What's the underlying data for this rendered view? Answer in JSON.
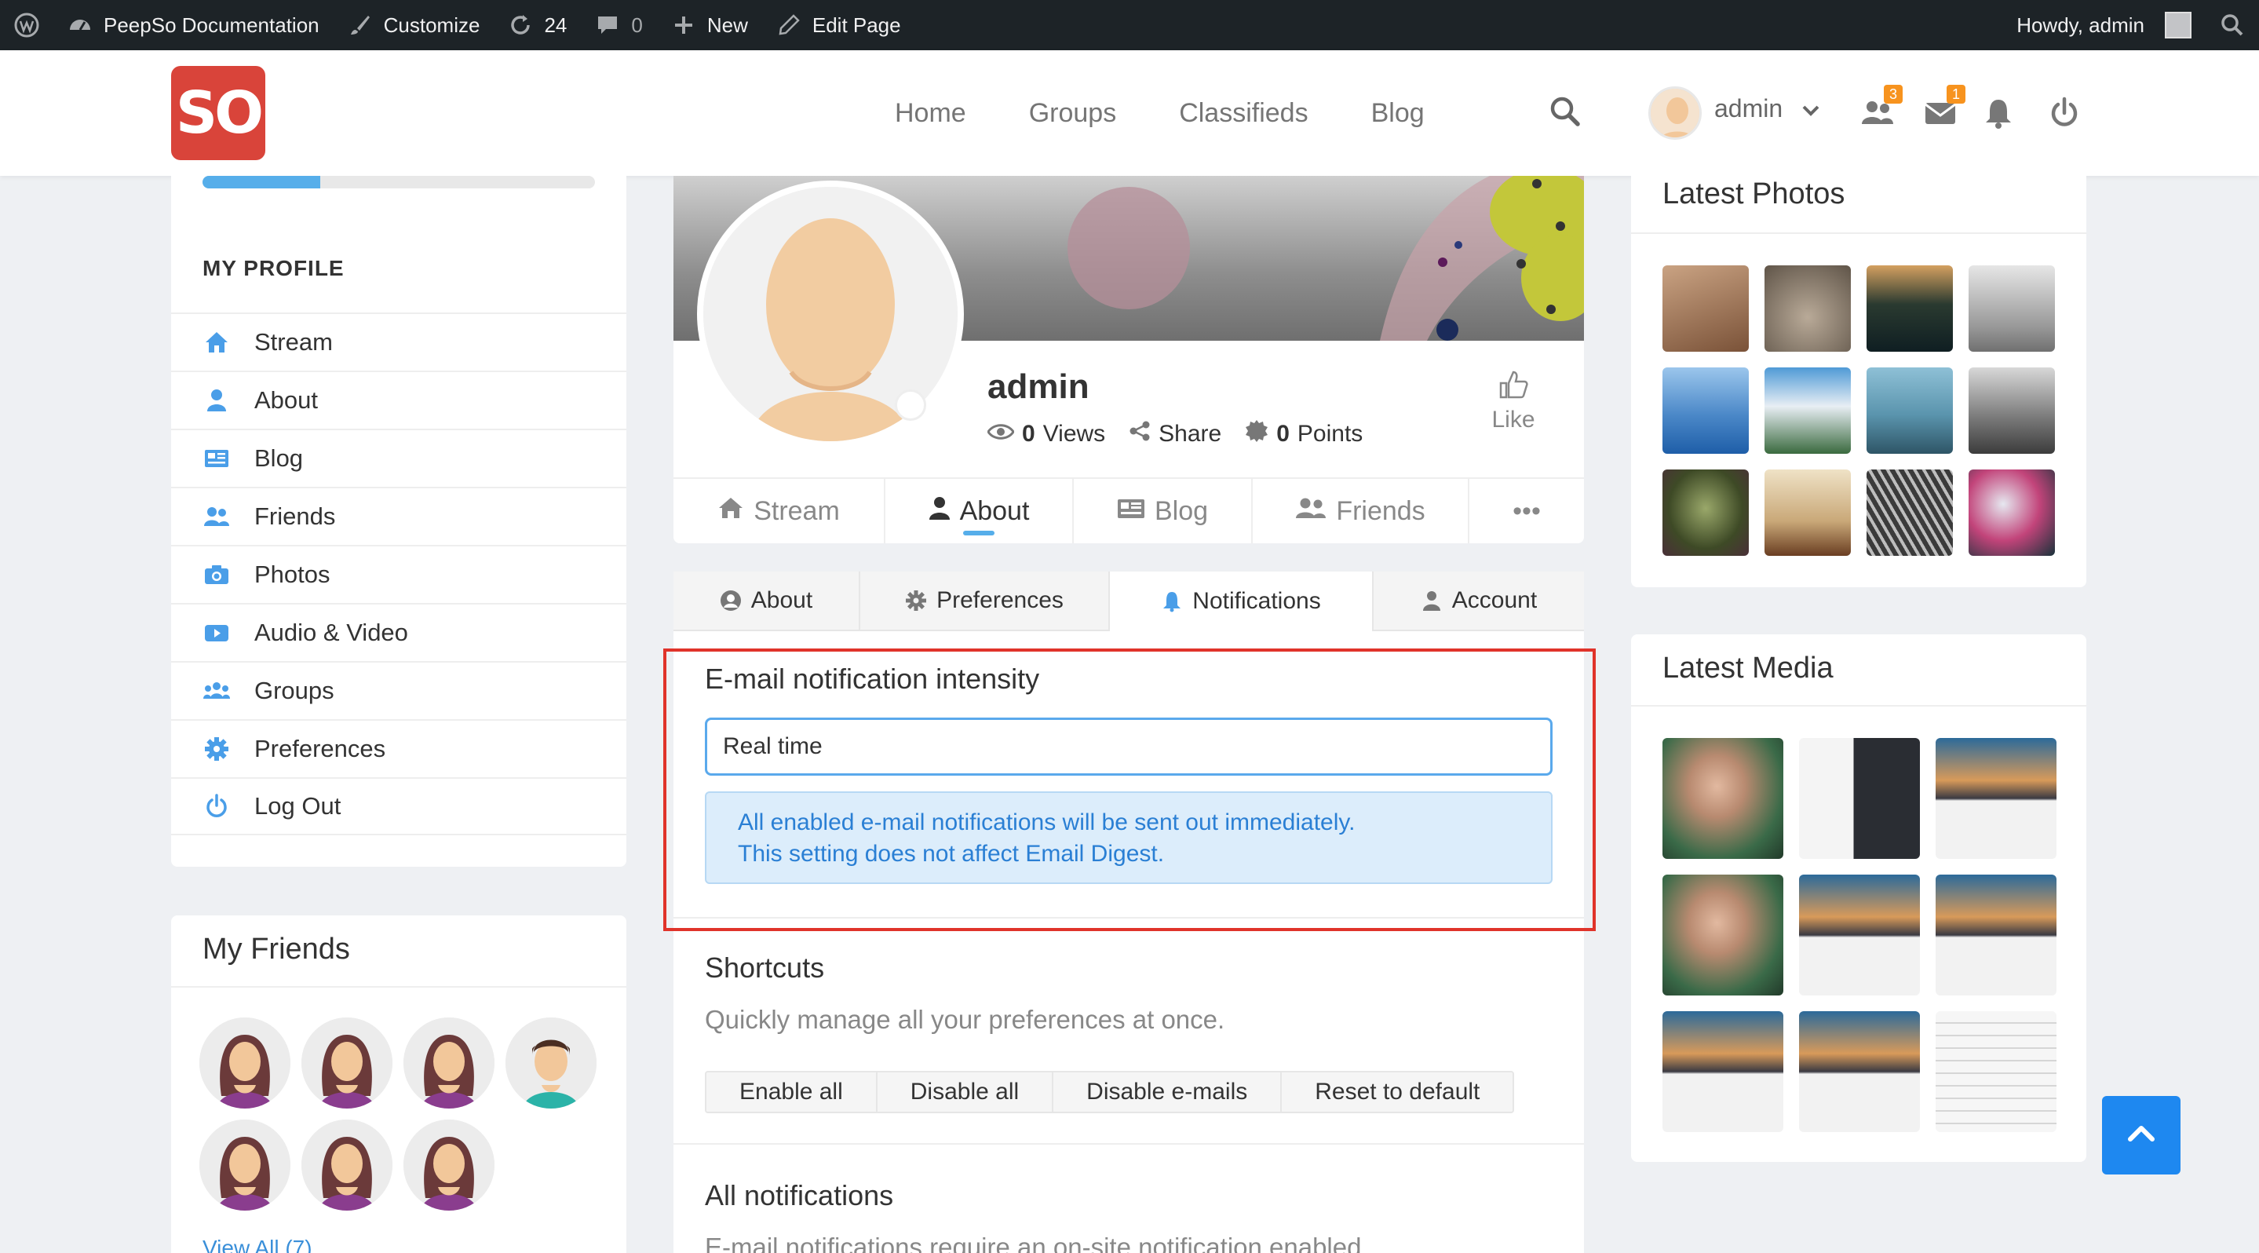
{
  "adminbar": {
    "site_name": "PeepSo Documentation",
    "customize": "Customize",
    "updates_count": "24",
    "comments_count": "0",
    "new": "New",
    "edit_page": "Edit Page",
    "howdy": "Howdy, admin"
  },
  "header": {
    "logo": "SO",
    "nav": [
      "Home",
      "Groups",
      "Classifieds",
      "Blog"
    ],
    "username": "admin",
    "friends_badge": "3",
    "messages_badge": "1"
  },
  "sidebar": {
    "progress_percent": 30,
    "section_title": "MY PROFILE",
    "items": [
      "Stream",
      "About",
      "Blog",
      "Friends",
      "Photos",
      "Audio & Video",
      "Groups",
      "Preferences",
      "Log Out"
    ]
  },
  "friends": {
    "title": "My Friends",
    "view_all": "View All (7)"
  },
  "profile": {
    "name": "admin",
    "views_count": "0",
    "views_label": "Views",
    "share_label": "Share",
    "points_count": "0",
    "points_label": "Points",
    "like_label": "Like",
    "tabs": [
      "Stream",
      "About",
      "Blog",
      "Friends"
    ],
    "more": "•••"
  },
  "settings": {
    "tabs": [
      "About",
      "Preferences",
      "Notifications",
      "Account"
    ],
    "intensity_heading": "E-mail notification intensity",
    "intensity_value": "Real time",
    "intensity_info_line1": "All enabled e-mail notifications will be sent out immediately.",
    "intensity_info_line2": "This setting does not affect Email Digest.",
    "shortcuts_heading": "Shortcuts",
    "shortcuts_desc": "Quickly manage all your preferences at once.",
    "shortcut_buttons": [
      "Enable all",
      "Disable all",
      "Disable e-mails",
      "Reset to default"
    ],
    "all_heading": "All notifications",
    "all_desc": "E-mail notifications require an on-site notification enabled"
  },
  "right": {
    "photos_title": "Latest Photos",
    "media_title": "Latest Media"
  },
  "colors": {
    "accent": "#56aeea",
    "brand": "#d9443a",
    "highlight": "#e0332a"
  }
}
